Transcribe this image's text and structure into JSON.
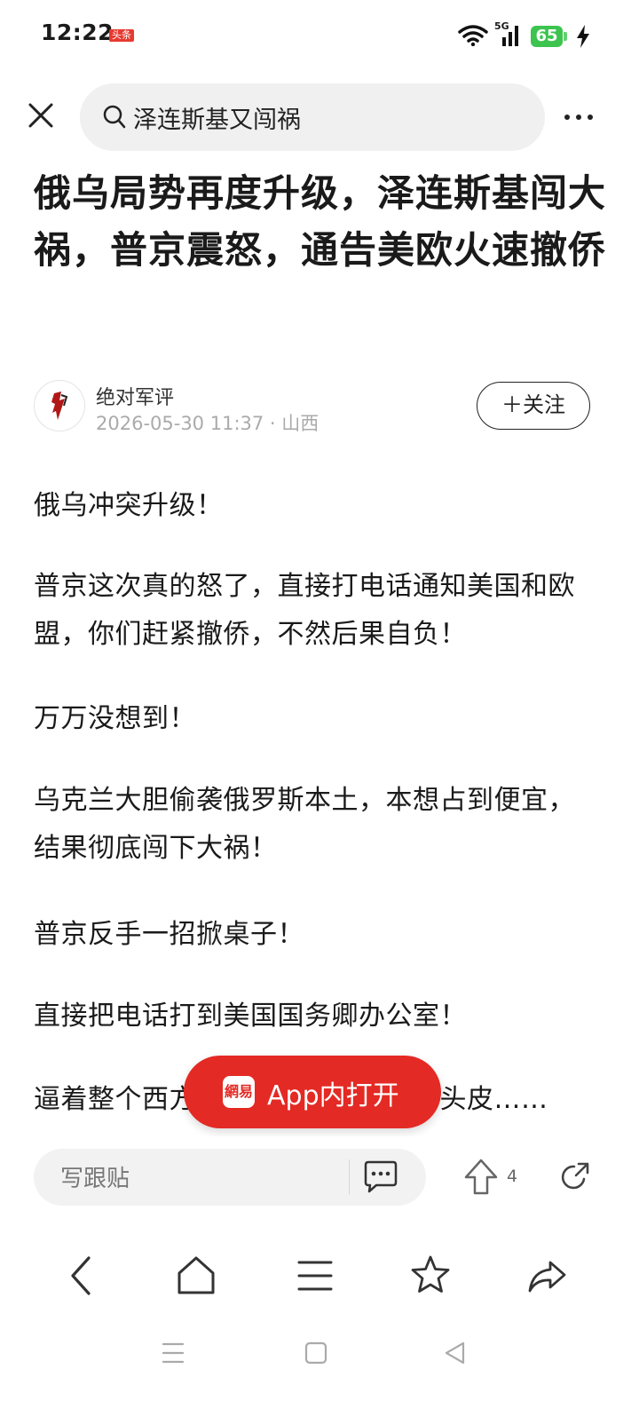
{
  "status_bar": {
    "time": "12:22",
    "badge": "头条",
    "network": "5G",
    "battery": "65"
  },
  "search": {
    "query": "泽连斯基又闯祸"
  },
  "article": {
    "title": "俄乌局势再度升级，泽连斯基闯大祸，普京震怒，通告美欧火速撤侨",
    "author": "绝对军评",
    "meta": "2026-05-30 11:37 · 山西",
    "follow_label": "＋关注",
    "paragraphs": [
      "俄乌冲突升级！",
      "普京这次真的怒了，直接打电话通知美国和欧盟，你们赶紧撤侨，不然后果自负！",
      "万万没想到！",
      "乌克兰大胆偷袭俄罗斯本土，本想占到便宜，结果彻底闯下大祸！",
      "普京反手一招掀桌子！",
      "直接把电话打到美国国务卿办公室！",
      "逼着整个西方国家赶紧撤侨，硬着头皮……"
    ]
  },
  "open_app": {
    "logo": "網易",
    "label": "App内打开"
  },
  "comment_bar": {
    "placeholder": "写跟贴",
    "upvote_count": "4"
  },
  "icons": {
    "close": "close-icon",
    "search": "search-icon",
    "more": "more-icon",
    "comment": "comment-icon",
    "upvote": "upvote-arrow-icon",
    "share": "share-icon",
    "back": "back-icon",
    "home": "home-icon",
    "menu": "menu-icon",
    "favorite": "star-icon",
    "forward": "forward-share-icon"
  },
  "colors": {
    "accent_red": "#e42a24",
    "battery_green": "#3cc44e"
  }
}
